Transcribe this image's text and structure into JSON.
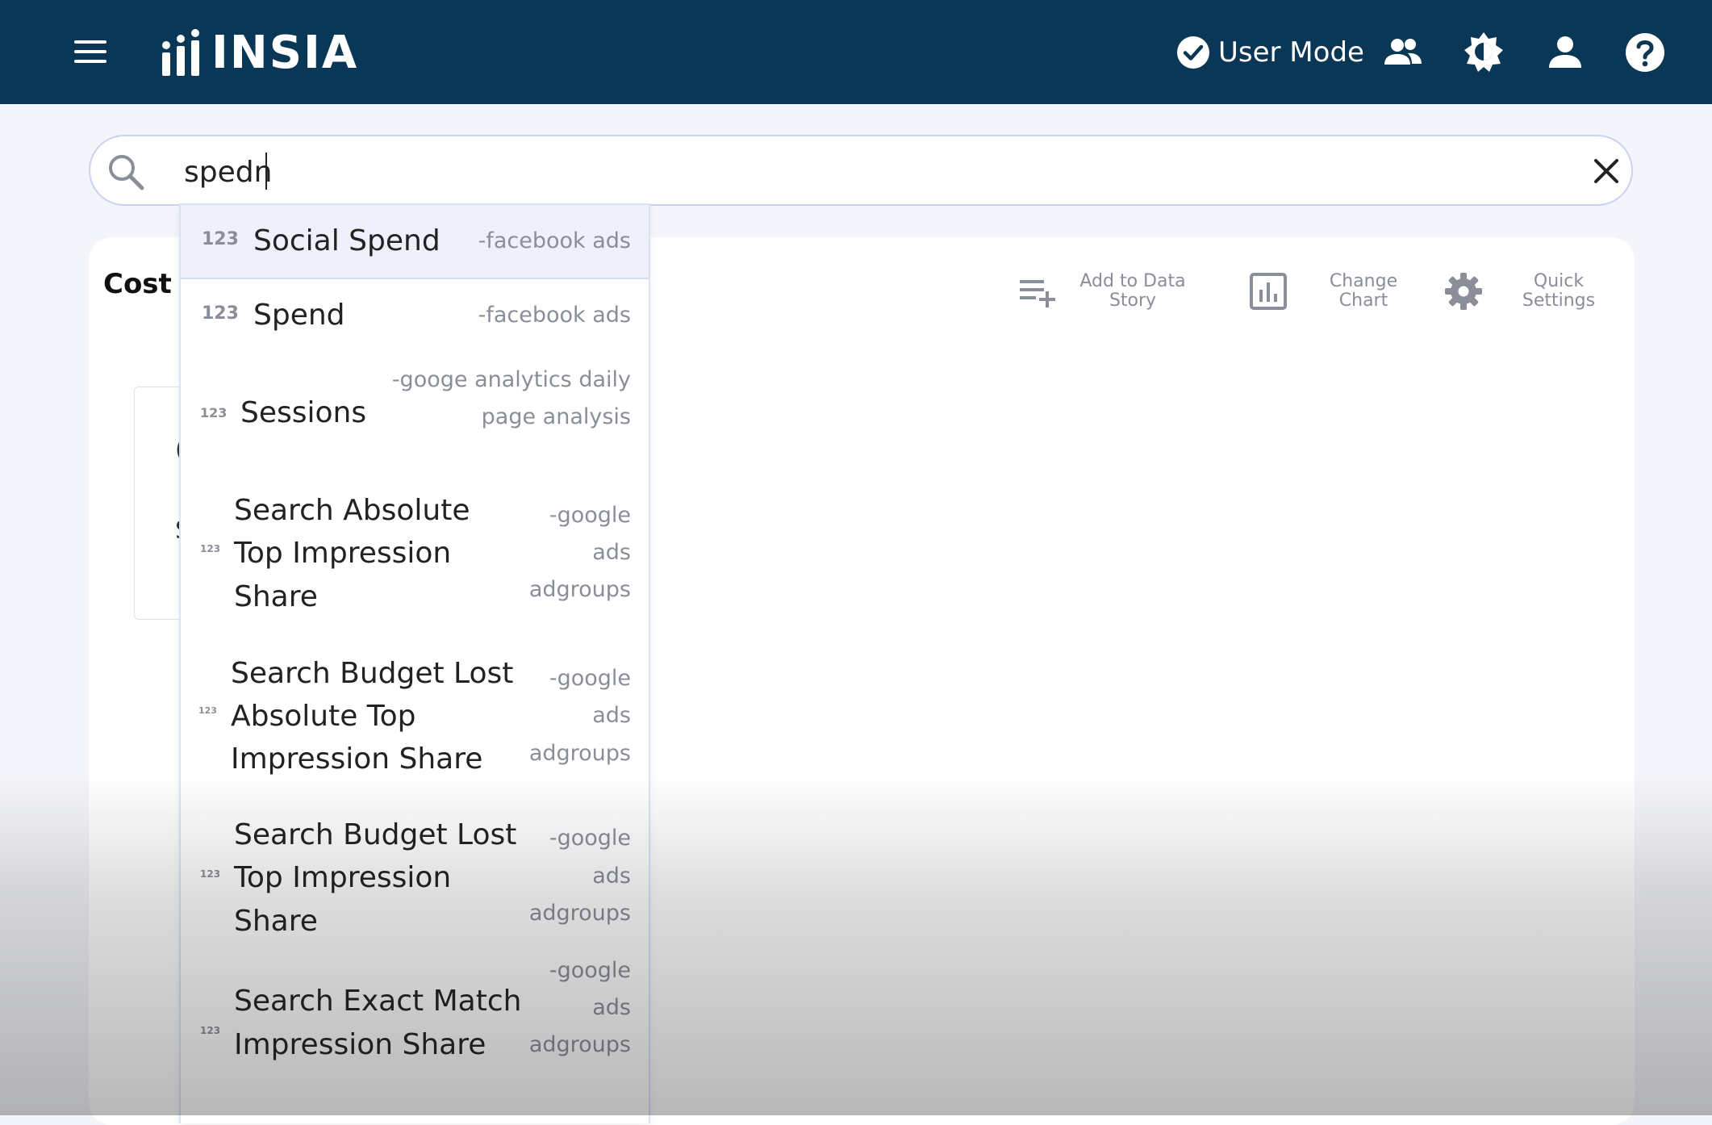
{
  "header": {
    "app_name": "INSIA",
    "user_mode_label": "User Mode",
    "icons": [
      "menu-icon",
      "insia-logo",
      "check-circle-icon",
      "people-icon",
      "brightness-icon",
      "account-icon",
      "help-icon"
    ]
  },
  "search": {
    "value": "spedn",
    "placeholder": ""
  },
  "card": {
    "title": "Cost F",
    "box_fragments": [
      "(",
      "S"
    ]
  },
  "toolbar": {
    "add_to_story_line1": "Add to Data",
    "add_to_story_line2": "Story",
    "change_chart_line1": "Change",
    "change_chart_line2": "Chart",
    "quick_settings_line1": "Quick",
    "quick_settings_line2": "Settings"
  },
  "suggestions": [
    {
      "type": "123",
      "name_lines": [
        "Social Spend"
      ],
      "source_lines": [
        "-facebook ads"
      ]
    },
    {
      "type": "123",
      "name_lines": [
        "Spend"
      ],
      "source_lines": [
        "-facebook ads"
      ]
    },
    {
      "type": "123",
      "name_lines": [
        "Sessions"
      ],
      "source_lines": [
        "-googe analytics daily",
        "page analysis"
      ]
    },
    {
      "type": "123",
      "name_lines": [
        "Search Absolute",
        "Top Impression",
        "Share"
      ],
      "source_lines": [
        "-google",
        "ads",
        "adgroups"
      ]
    },
    {
      "type": "123",
      "name_lines": [
        "Search Budget Lost",
        "Absolute Top",
        "Impression Share"
      ],
      "source_lines": [
        "-google",
        "ads",
        "adgroups"
      ]
    },
    {
      "type": "123",
      "name_lines": [
        "Search Budget Lost",
        "Top Impression",
        "Share"
      ],
      "source_lines": [
        "-google",
        "ads",
        "adgroups"
      ]
    },
    {
      "type": "123",
      "name_lines": [
        "Search Exact Match",
        "Impression Share"
      ],
      "source_lines": [
        "-google",
        "ads",
        "adgroups"
      ]
    }
  ],
  "colors": {
    "header_bg": "#0b3756",
    "page_bg": "#f4f5fa",
    "active_row_bg": "#eef1fb",
    "muted_text": "#8a8e99"
  }
}
